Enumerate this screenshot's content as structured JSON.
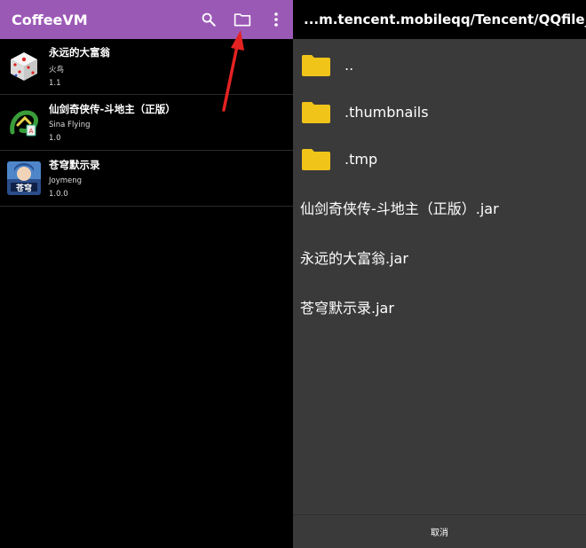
{
  "app": {
    "title": "CoffeeVM",
    "actions": {
      "search_icon": "search-icon",
      "folder_icon": "folder-icon",
      "more_icon": "more-vert-icon"
    },
    "accent_color": "#9b59b6"
  },
  "games": [
    {
      "name": "永远的大富翁",
      "vendor": "火鸟",
      "version": "1.1"
    },
    {
      "name": "仙剑奇侠传-斗地主（正版）",
      "vendor": "Sina Flying",
      "version": "1.0"
    },
    {
      "name": "苍穹默示录",
      "vendor": "Joymeng",
      "version": "1.0.0"
    }
  ],
  "picker": {
    "path": "...m.tencent.mobileqq/Tencent/QQfile_recv",
    "folders": [
      {
        "name": ".."
      },
      {
        "name": ".thumbnails"
      },
      {
        "name": ".tmp"
      }
    ],
    "files": [
      {
        "name": "仙剑奇侠传-斗地主（正版）.jar"
      },
      {
        "name": "永远的大富翁.jar"
      },
      {
        "name": "苍穹默示录.jar"
      }
    ],
    "cancel_label": "取消",
    "folder_color": "#f0c419"
  }
}
